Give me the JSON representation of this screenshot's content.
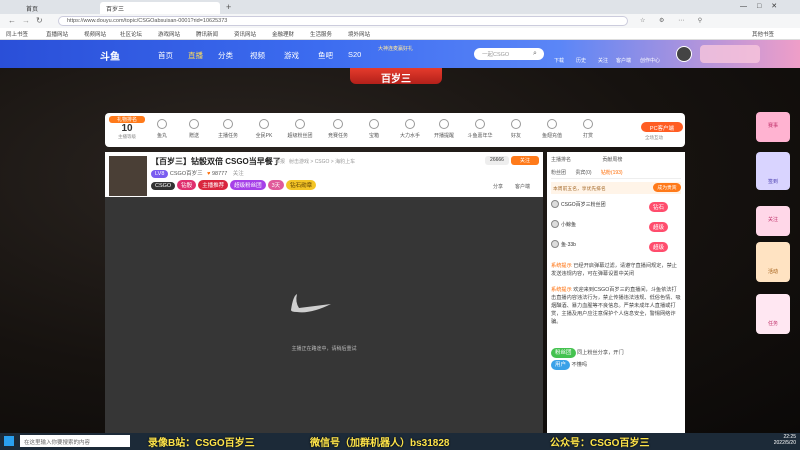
{
  "browser": {
    "tabs": [
      {
        "label": "首页"
      },
      {
        "label": "百岁三"
      }
    ],
    "url": "https://www.douyu.com/topic/CSGOabsuisan-0001?rid=10625373",
    "bookmarks": [
      "同上书签",
      "直播网站",
      "视频网站",
      "社区论坛",
      "游戏网站",
      "腾讯新闻",
      "资讯网站",
      "金融理财",
      "生活服务",
      "境外网站",
      "其他书签"
    ]
  },
  "site": {
    "logo": "斗鱼",
    "nav": [
      "首页",
      "直播",
      "分类",
      "视频",
      "游戏",
      "鱼吧",
      "S20"
    ],
    "banner_title": "百岁三",
    "banner_sub": "大神连麦赢好礼",
    "search_placeholder": "一起CSGO",
    "header_icons": [
      "下载",
      "历史",
      "关注",
      "客户端",
      "创作中心"
    ]
  },
  "room": {
    "rank_label": "礼物排名",
    "rank_num": "10",
    "rank_sub": "主播等级",
    "title": "【百岁三】钻骰双倍 CSGO当早餐了",
    "report": "举报",
    "breadcrumb": "射击游戏 > CSGO > 海豹上车",
    "streamer": "CSGO百岁三",
    "level": "LV8",
    "fans": "98777",
    "follow_btn": "关注",
    "tags": [
      "CSGO",
      "钻骰",
      "主播推荐",
      "超级粉丝团",
      "3天",
      "钻石勋章"
    ],
    "follow_count": "26666",
    "share": "分享",
    "client": "客户端",
    "loading_text": "主播正在路途中，请稍后重试",
    "gifts": [
      "鱼丸",
      "赠送",
      "主播任务",
      "全民PK",
      "超级粉丝团",
      "竞赛任务",
      "宝箱",
      "大力水手",
      "开播提醒",
      "斗鱼嘉年华",
      "好友",
      "鱼翅充值",
      "打赏"
    ],
    "pc_btn": "PC客户端",
    "pc_sub": "全场互动"
  },
  "chat": {
    "tabs": [
      "主播排名",
      "贡献周榜",
      "粉丝团",
      "贵宾(0)",
      "钻粉(193)"
    ],
    "rank_banner": "本周前五名，享优先排名",
    "join_btn": "成为贵宾",
    "ranks": [
      {
        "name": "CSGO百岁三粉丝团",
        "badge": "钻石"
      },
      {
        "name": "小鲸鱼",
        "badge": "超级"
      },
      {
        "name": "鱼·33b",
        "badge": "超级"
      }
    ],
    "messages": [
      {
        "tag": "系统提示",
        "text": "已经开启弹幕过滤，请遵守直播间规定，禁止发送违规内容，可在弹幕设置中关闭"
      },
      {
        "tag": "系统提示",
        "text": "欢迎来到CSGO百岁三的直播间，斗鱼依法打击直播内容违法行为，禁止传播违法违规、低俗色情、吸烟酗酒、暴力血腥等不良信息。严禁未成年人直播或打赏，主播及用户应注意保护个人信息安全，警惕网络诈骗。"
      },
      {
        "tag": "粉丝团",
        "text": "同上粉丝分享，开门"
      },
      {
        "tag": "用户",
        "text": "不懂吗"
      }
    ]
  },
  "sidebar": [
    "赛事",
    "签到",
    "关注",
    "活动",
    "任务",
    "直播"
  ],
  "taskbar": {
    "search": "在这里输入你要搜索的内容",
    "time": "22:25",
    "date": "2022/5/20"
  },
  "watermarks": [
    "录像B站：CSGO百岁三",
    "微信号（加群机器人）bs31828",
    "公众号：CSGO百岁三"
  ]
}
